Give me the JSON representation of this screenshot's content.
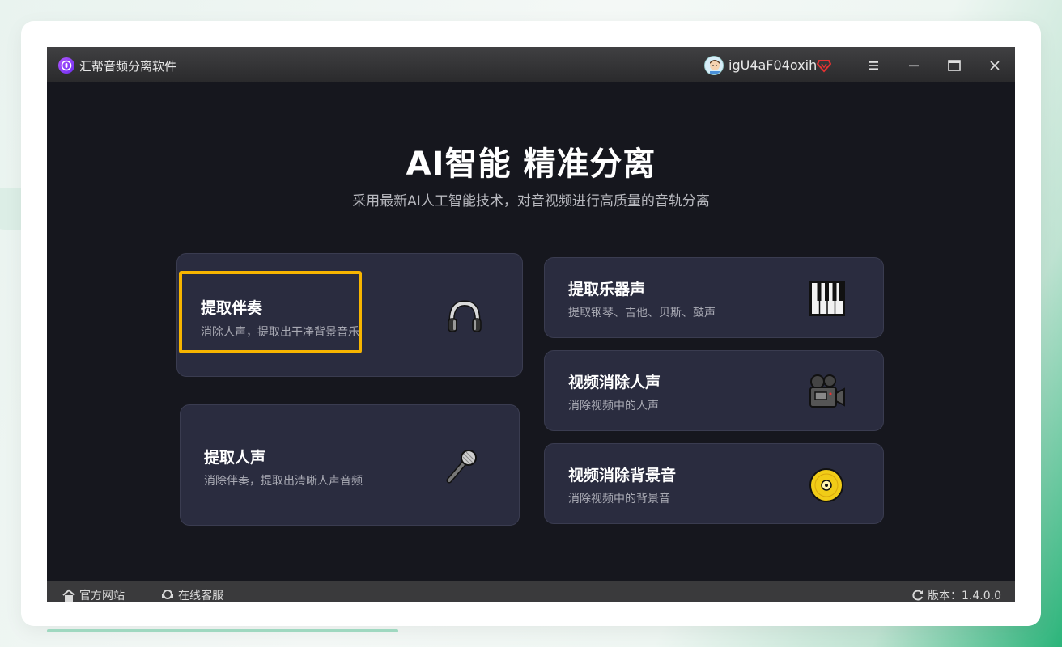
{
  "window": {
    "app_title": "汇帮音频分离软件",
    "user_name": "igU4aF04oxih"
  },
  "hero": {
    "title": "AI智能 精准分离",
    "subtitle": "采用最新AI人工智能技术，对音视频进行高质量的音轨分离"
  },
  "features": [
    {
      "title": "提取伴奏",
      "desc": "消除人声，提取出干净背景音乐",
      "icon": "headphones-icon"
    },
    {
      "title": "提取人声",
      "desc": "消除伴奏，提取出清晰人声音频",
      "icon": "microphone-icon"
    },
    {
      "title": "提取乐器声",
      "desc": "提取钢琴、吉他、贝斯、鼓声",
      "icon": "piano-icon"
    },
    {
      "title": "视频消除人声",
      "desc": "消除视频中的人声",
      "icon": "movie-camera-icon"
    },
    {
      "title": "视频消除背景音",
      "desc": "消除视频中的背景音",
      "icon": "dvd-disc-icon"
    }
  ],
  "statusbar": {
    "website": "官方网站",
    "support": "在线客服",
    "version": "版本：1.4.0.0"
  },
  "colors": {
    "accent_highlight": "#f7b500",
    "card_bg": "#2a2c3f",
    "window_bg": "#16171e"
  }
}
